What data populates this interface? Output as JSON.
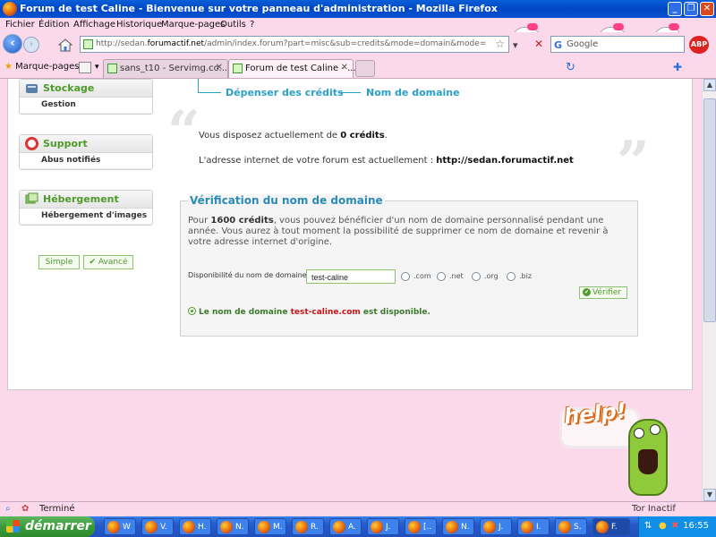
{
  "window": {
    "title": "Forum de test Caline - Bienvenue sur votre panneau d'administration - Mozilla Firefox"
  },
  "menu": [
    "Fichier",
    "Édition",
    "Affichage",
    "Historique",
    "Marque-pages",
    "Outils",
    "?"
  ],
  "nav": {
    "url_prefix": "http://sedan.",
    "url_host": "forumactif.net",
    "url_rest": "/admin/index.forum?part=misc&sub=credits&mode=domain&mode=check&extended_",
    "search_placeholder": "Google"
  },
  "bookmarks": {
    "label": "Marque-pages"
  },
  "tabs": [
    {
      "label": "sans_t10 - Servimg.co...",
      "active": false
    },
    {
      "label": "Forum de test Caline - ...",
      "active": true
    }
  ],
  "sidebar": {
    "boxes": [
      {
        "title": "Stockage",
        "items": [
          "Gestion"
        ]
      },
      {
        "title": "Support",
        "items": [
          "Abus notifiés"
        ]
      },
      {
        "title": "Hébergement",
        "items": [
          "Hébergement d'images"
        ]
      }
    ],
    "mode_simple": "Simple",
    "mode_advanced": "Avancé"
  },
  "breadcrumb": {
    "step1": "Dépenser des crédits",
    "step2": "Nom de domaine"
  },
  "credits": {
    "line_prefix": "Vous disposez actuellement de ",
    "amount": "0 crédits",
    "line_suffix": ".",
    "address_label": "L'adresse internet de votre forum est actuellement : ",
    "address": "http://sedan.forumactif.net"
  },
  "verification": {
    "title": "Vérification du nom de domaine",
    "desc_prefix": "Pour ",
    "desc_credits": "1600 crédits",
    "desc_rest": ", vous pouvez bénéficier d'un nom de domaine personnalisé pendant une année. Vous aurez à tout moment la possibilité de supprimer ce nom de domaine et revenir à votre adresse internet d'origine.",
    "field_label": "Disponibilité du nom de domaine :",
    "field_value": "test-caline",
    "extensions": [
      ".com",
      ".net",
      ".org",
      ".biz"
    ],
    "verify_label": "Vérifier",
    "result_prefix": "Le nom de domaine ",
    "result_domain": "test-caline.com",
    "result_suffix": " est disponible."
  },
  "help": {
    "text": "help!"
  },
  "status": {
    "text": "Terminé",
    "tor": "Tor Inactif"
  },
  "taskbar": {
    "start": "démarrer",
    "items": [
      "W",
      "V.",
      "H.",
      "N.",
      "M.",
      "R.",
      "A.",
      "J.",
      "[..",
      "N.",
      "J.",
      "I.",
      "S.",
      "F."
    ],
    "clock": "16:55"
  }
}
